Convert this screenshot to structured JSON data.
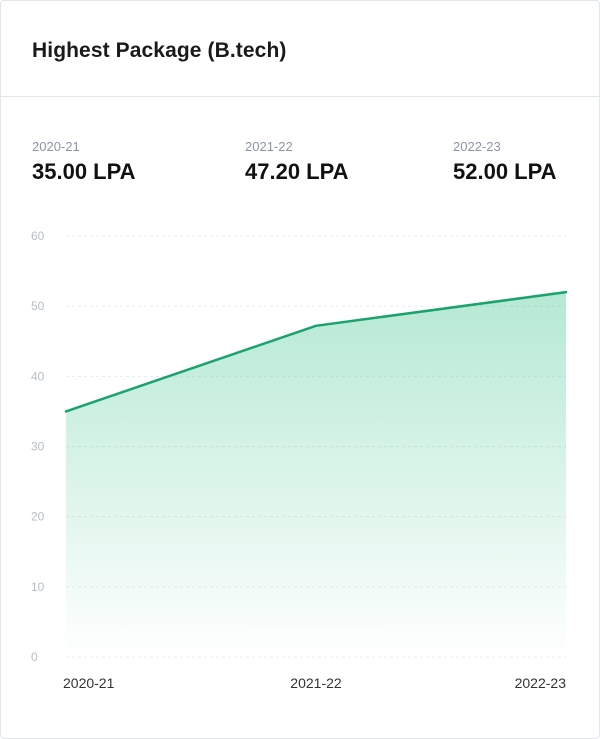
{
  "card": {
    "title": "Highest Package (B.tech)"
  },
  "stats": [
    {
      "label": "2020-21",
      "value": "35.00 LPA"
    },
    {
      "label": "2021-22",
      "value": "47.20 LPA"
    },
    {
      "label": "2022-23",
      "value": "52.00 LPA"
    }
  ],
  "colors": {
    "line": "#1aa36c",
    "area": "#3cc48c",
    "grid": "#e8ecf0",
    "tick": "#b5bfca",
    "xtick": "#333333"
  },
  "chart_data": {
    "type": "area",
    "categories": [
      "2020-21",
      "2021-22",
      "2022-23"
    ],
    "series": [
      {
        "values": [
          35.0,
          47.2,
          52.0
        ]
      }
    ],
    "ylim": [
      0,
      60
    ],
    "yticks": [
      0,
      10,
      20,
      30,
      40,
      50,
      60
    ],
    "grid": true,
    "xlabel": "",
    "ylabel": ""
  }
}
